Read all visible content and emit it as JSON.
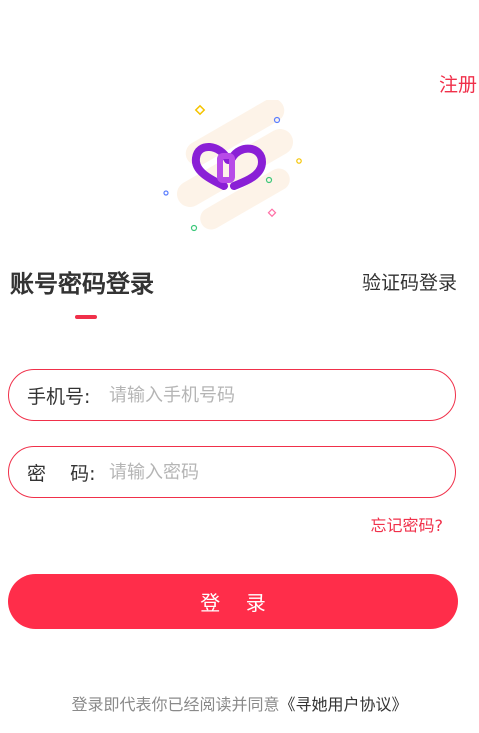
{
  "header": {
    "register_label": "注册"
  },
  "tabs": {
    "active_label": "账号密码登录",
    "other_label": "验证码登录"
  },
  "form": {
    "phone_label": "手机号:",
    "phone_placeholder": "请输入手机号码",
    "password_label": "密    码:",
    "password_placeholder": "请输入密码",
    "forgot_label": "忘记密码?",
    "login_label": "登    录"
  },
  "agreement": {
    "prefix": "登录即代表你已经阅读并同意",
    "link": "《寻她用户协议》"
  },
  "colors": {
    "accent": "#f0304a",
    "button": "#ff2d4a",
    "logo_purple": "#8a1fd6"
  },
  "icons": {
    "logo": "heart-link-logo-icon"
  }
}
